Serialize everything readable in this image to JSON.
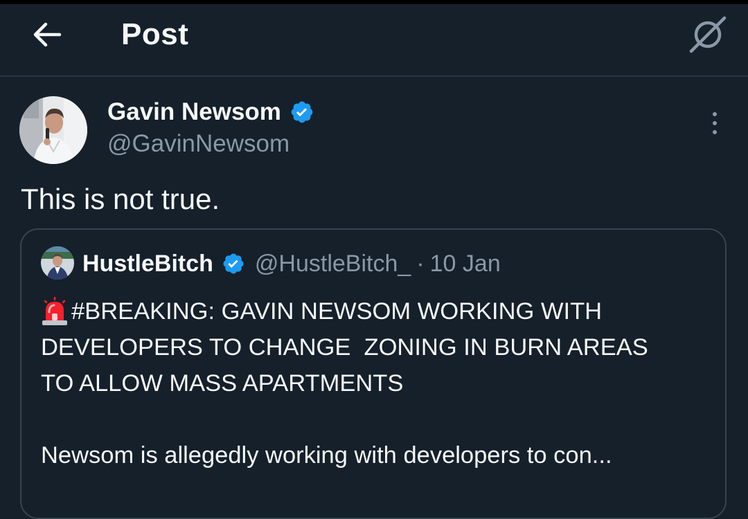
{
  "header": {
    "title": "Post",
    "back_icon": "arrow-left-icon",
    "grok_icon": "grok-icon"
  },
  "tweet": {
    "author_name": "Gavin Newsom",
    "author_handle": "@GavinNewsom",
    "text": "This is not true.",
    "verified_color": "#1d9bf0"
  },
  "quote": {
    "author_name": "HustleBitch",
    "author_handle": "@HustleBitch_",
    "separator": "·",
    "date": "10 Jan",
    "lines": [
      "#BREAKING: GAVIN NEWSOM WORKING WITH",
      "DEVELOPERS TO CHANGE  ZONING IN BURN AREAS",
      "TO ALLOW MASS APARTMENTS",
      "Newsom is allegedly working with developers to con..."
    ],
    "lead_icon": "siren-icon"
  },
  "colors": {
    "background": "#15202b",
    "text": "#f7f9f9",
    "secondary_text": "#8b98a5",
    "border": "#38444d"
  }
}
